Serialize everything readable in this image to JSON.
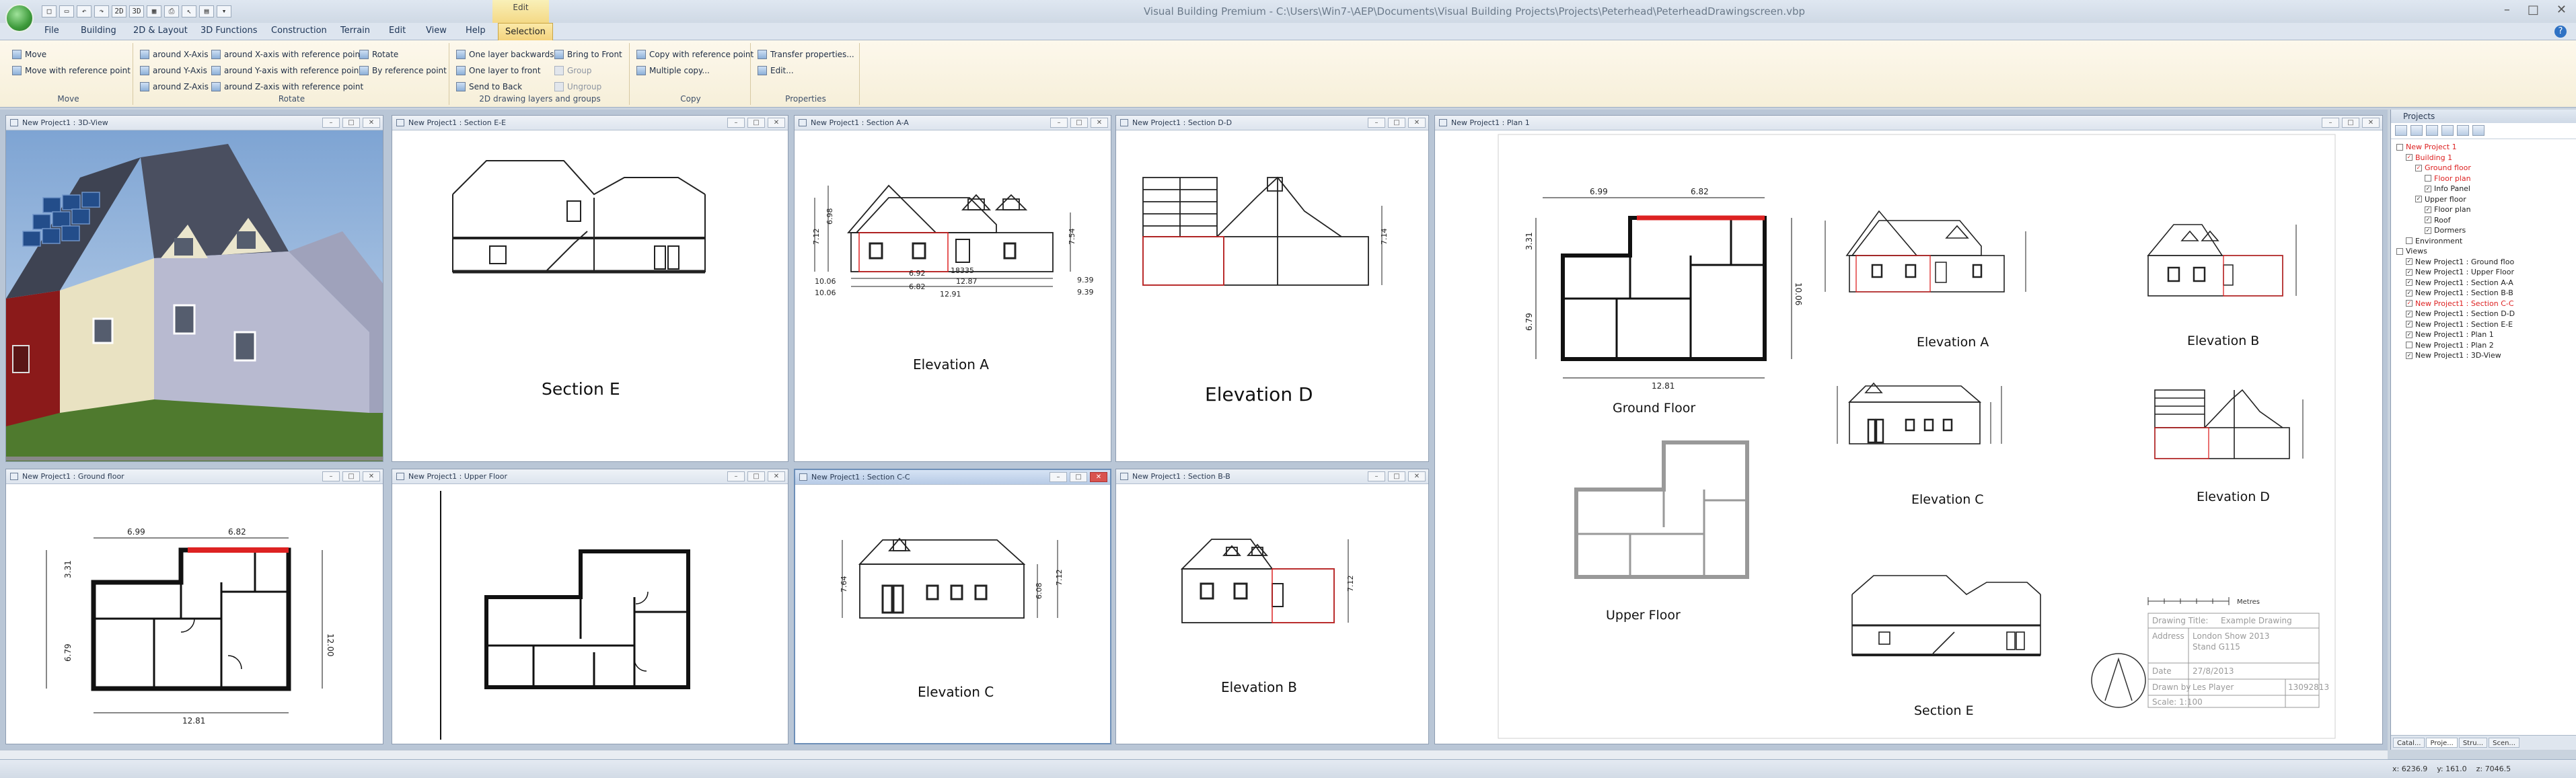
{
  "window": {
    "title": "Visual Building Premium - C:\\Users\\Win7-\\AEP\\Documents\\Visual Building Projects\\Projects\\Peterhead\\PeterheadDrawingscreen.vbp",
    "context_group": "Edit"
  },
  "quick_access": [
    "2D",
    "3D"
  ],
  "tabs": [
    "File",
    "Building",
    "2D & Layout",
    "3D Functions",
    "Construction",
    "Terrain",
    "Edit",
    "View",
    "Help",
    "Selection"
  ],
  "active_tab": "Selection",
  "ribbon": {
    "move": {
      "label": "Move",
      "items": [
        "Move",
        "Move with reference point"
      ]
    },
    "rotate": {
      "label": "Rotate",
      "items": [
        "around X-Axis",
        "around Y-Axis",
        "around Z-Axis",
        "around X-axis with reference point",
        "around Y-axis with reference point",
        "around Z-axis with reference point",
        "Rotate",
        "By reference point"
      ]
    },
    "layers": {
      "label": "2D drawing layers and groups",
      "items": [
        "One layer backwards",
        "One layer to front",
        "Send to Back",
        "Bring to Front",
        "Group",
        "Ungroup"
      ]
    },
    "copy": {
      "label": "Copy",
      "items": [
        "Copy with reference point",
        "Multiple copy..."
      ]
    },
    "properties": {
      "label": "Properties",
      "items": [
        "Transfer properties...",
        "Edit..."
      ]
    }
  },
  "panes": {
    "view3d": {
      "title": "New Project1 : 3D-View"
    },
    "section_e": {
      "title": "New Project1 : Section E-E",
      "label": "Section E"
    },
    "section_a": {
      "title": "New Project1 : Section A-A",
      "label": "Elevation A",
      "dims": [
        "7.12",
        "6.98",
        "7.54",
        "10.06",
        "10.06",
        "6.92",
        "12.87",
        "6.82",
        "12.91",
        "9.39",
        "9.39",
        "18335"
      ]
    },
    "section_d": {
      "title": "New Project1 : Section D-D",
      "label": "Elevation D",
      "dims": [
        "7.14"
      ]
    },
    "ground": {
      "title": "New Project1 : Ground floor",
      "dims": [
        "6.99",
        "6.82",
        "3.31",
        "12.00",
        "6.79",
        "12.81"
      ]
    },
    "upper": {
      "title": "New Project1 : Upper Floor"
    },
    "section_c": {
      "title": "New Project1 : Section C-C",
      "label": "Elevation C",
      "dims": [
        "7.64",
        "6.08",
        "7.12"
      ]
    },
    "section_b": {
      "title": "New Project1 : Section B-B",
      "label": "Elevation B",
      "dims": [
        "7.12"
      ]
    },
    "plan": {
      "title": "New Project1 : Plan 1",
      "labels": {
        "ground_floor": "Ground Floor",
        "elevation_a": "Elevation A",
        "elevation_b": "Elevation B",
        "elevation_c": "Elevation C",
        "elevation_d": "Elevation D",
        "upper_floor": "Upper Floor",
        "section_e": "Section E"
      },
      "ground_dims": [
        "6.99",
        "6.82",
        "3.31",
        "6.79",
        "12.81",
        "10.06"
      ],
      "scale_bar_unit": "Metres",
      "title_block": [
        {
          "key": "Drawing Title:",
          "value": "Example Drawing"
        },
        {
          "key": "Address",
          "value": "London Show 2013"
        },
        {
          "key": "",
          "value": "Stand G115"
        },
        {
          "key": "Date",
          "value": "27/8/2013"
        },
        {
          "key": "Drawn by",
          "value": "Les Player"
        },
        {
          "key": "Scale: 1:100",
          "value": ""
        }
      ],
      "drawing_number": "13092813"
    }
  },
  "sidebar": {
    "title": "Projects",
    "tree": [
      {
        "label": "New Project 1",
        "level": 0,
        "red": true,
        "checked": false
      },
      {
        "label": "Building 1",
        "level": 1,
        "red": true,
        "checked": true
      },
      {
        "label": "Ground floor",
        "level": 2,
        "red": true,
        "checked": true
      },
      {
        "label": "Floor plan",
        "level": 3,
        "red": true,
        "checked": false
      },
      {
        "label": "Info Panel",
        "level": 3,
        "red": false,
        "checked": true
      },
      {
        "label": "Upper floor",
        "level": 2,
        "red": false,
        "checked": true
      },
      {
        "label": "Floor plan",
        "level": 3,
        "red": false,
        "checked": true
      },
      {
        "label": "Roof",
        "level": 3,
        "red": false,
        "checked": true
      },
      {
        "label": "Dormers",
        "level": 3,
        "red": false,
        "checked": true
      },
      {
        "label": "Environment",
        "level": 1,
        "red": false,
        "checked": false
      },
      {
        "label": "Views",
        "level": 0,
        "red": false,
        "checked": false
      },
      {
        "label": "New Project1 : Ground floo",
        "level": 1,
        "red": false,
        "checked": true
      },
      {
        "label": "New Project1 : Upper Floor",
        "level": 1,
        "red": false,
        "checked": true
      },
      {
        "label": "New Project1 : Section A-A",
        "level": 1,
        "red": false,
        "checked": true
      },
      {
        "label": "New Project1 : Section B-B",
        "level": 1,
        "red": false,
        "checked": true
      },
      {
        "label": "New Project1 : Section C-C",
        "level": 1,
        "red": true,
        "checked": true
      },
      {
        "label": "New Project1 : Section D-D",
        "level": 1,
        "red": false,
        "checked": true
      },
      {
        "label": "New Project1 : Section E-E",
        "level": 1,
        "red": false,
        "checked": true
      },
      {
        "label": "New Project1 : Plan 1",
        "level": 1,
        "red": false,
        "checked": true
      },
      {
        "label": "New Project1 : Plan 2",
        "level": 1,
        "red": false,
        "checked": false
      },
      {
        "label": "New Project1 : 3D-View",
        "level": 1,
        "red": false,
        "checked": true
      }
    ],
    "bottom_tabs": [
      "Catal...",
      "Proje...",
      "Stru...",
      "Scen..."
    ]
  },
  "status": {
    "x": "x: 6236.9",
    "y": "y: 161.0",
    "z": "z: 7046.5"
  },
  "colors": {
    "ribbon_active": "#f3d27c",
    "highlight_red": "#d22222",
    "sky": "#a8c2e2",
    "grass": "#4f7a2e"
  }
}
